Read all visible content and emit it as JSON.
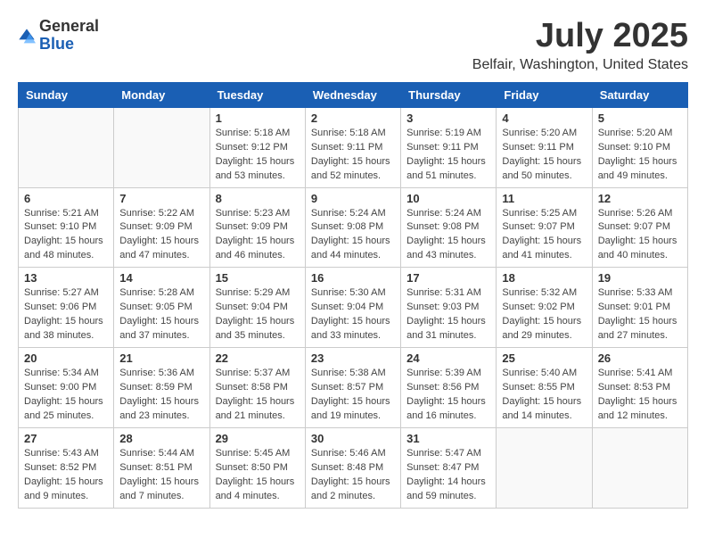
{
  "logo": {
    "general": "General",
    "blue": "Blue"
  },
  "title": "July 2025",
  "location": "Belfair, Washington, United States",
  "weekdays": [
    "Sunday",
    "Monday",
    "Tuesday",
    "Wednesday",
    "Thursday",
    "Friday",
    "Saturday"
  ],
  "weeks": [
    [
      {
        "day": "",
        "info": ""
      },
      {
        "day": "",
        "info": ""
      },
      {
        "day": "1",
        "info": "Sunrise: 5:18 AM\nSunset: 9:12 PM\nDaylight: 15 hours\nand 53 minutes."
      },
      {
        "day": "2",
        "info": "Sunrise: 5:18 AM\nSunset: 9:11 PM\nDaylight: 15 hours\nand 52 minutes."
      },
      {
        "day": "3",
        "info": "Sunrise: 5:19 AM\nSunset: 9:11 PM\nDaylight: 15 hours\nand 51 minutes."
      },
      {
        "day": "4",
        "info": "Sunrise: 5:20 AM\nSunset: 9:11 PM\nDaylight: 15 hours\nand 50 minutes."
      },
      {
        "day": "5",
        "info": "Sunrise: 5:20 AM\nSunset: 9:10 PM\nDaylight: 15 hours\nand 49 minutes."
      }
    ],
    [
      {
        "day": "6",
        "info": "Sunrise: 5:21 AM\nSunset: 9:10 PM\nDaylight: 15 hours\nand 48 minutes."
      },
      {
        "day": "7",
        "info": "Sunrise: 5:22 AM\nSunset: 9:09 PM\nDaylight: 15 hours\nand 47 minutes."
      },
      {
        "day": "8",
        "info": "Sunrise: 5:23 AM\nSunset: 9:09 PM\nDaylight: 15 hours\nand 46 minutes."
      },
      {
        "day": "9",
        "info": "Sunrise: 5:24 AM\nSunset: 9:08 PM\nDaylight: 15 hours\nand 44 minutes."
      },
      {
        "day": "10",
        "info": "Sunrise: 5:24 AM\nSunset: 9:08 PM\nDaylight: 15 hours\nand 43 minutes."
      },
      {
        "day": "11",
        "info": "Sunrise: 5:25 AM\nSunset: 9:07 PM\nDaylight: 15 hours\nand 41 minutes."
      },
      {
        "day": "12",
        "info": "Sunrise: 5:26 AM\nSunset: 9:07 PM\nDaylight: 15 hours\nand 40 minutes."
      }
    ],
    [
      {
        "day": "13",
        "info": "Sunrise: 5:27 AM\nSunset: 9:06 PM\nDaylight: 15 hours\nand 38 minutes."
      },
      {
        "day": "14",
        "info": "Sunrise: 5:28 AM\nSunset: 9:05 PM\nDaylight: 15 hours\nand 37 minutes."
      },
      {
        "day": "15",
        "info": "Sunrise: 5:29 AM\nSunset: 9:04 PM\nDaylight: 15 hours\nand 35 minutes."
      },
      {
        "day": "16",
        "info": "Sunrise: 5:30 AM\nSunset: 9:04 PM\nDaylight: 15 hours\nand 33 minutes."
      },
      {
        "day": "17",
        "info": "Sunrise: 5:31 AM\nSunset: 9:03 PM\nDaylight: 15 hours\nand 31 minutes."
      },
      {
        "day": "18",
        "info": "Sunrise: 5:32 AM\nSunset: 9:02 PM\nDaylight: 15 hours\nand 29 minutes."
      },
      {
        "day": "19",
        "info": "Sunrise: 5:33 AM\nSunset: 9:01 PM\nDaylight: 15 hours\nand 27 minutes."
      }
    ],
    [
      {
        "day": "20",
        "info": "Sunrise: 5:34 AM\nSunset: 9:00 PM\nDaylight: 15 hours\nand 25 minutes."
      },
      {
        "day": "21",
        "info": "Sunrise: 5:36 AM\nSunset: 8:59 PM\nDaylight: 15 hours\nand 23 minutes."
      },
      {
        "day": "22",
        "info": "Sunrise: 5:37 AM\nSunset: 8:58 PM\nDaylight: 15 hours\nand 21 minutes."
      },
      {
        "day": "23",
        "info": "Sunrise: 5:38 AM\nSunset: 8:57 PM\nDaylight: 15 hours\nand 19 minutes."
      },
      {
        "day": "24",
        "info": "Sunrise: 5:39 AM\nSunset: 8:56 PM\nDaylight: 15 hours\nand 16 minutes."
      },
      {
        "day": "25",
        "info": "Sunrise: 5:40 AM\nSunset: 8:55 PM\nDaylight: 15 hours\nand 14 minutes."
      },
      {
        "day": "26",
        "info": "Sunrise: 5:41 AM\nSunset: 8:53 PM\nDaylight: 15 hours\nand 12 minutes."
      }
    ],
    [
      {
        "day": "27",
        "info": "Sunrise: 5:43 AM\nSunset: 8:52 PM\nDaylight: 15 hours\nand 9 minutes."
      },
      {
        "day": "28",
        "info": "Sunrise: 5:44 AM\nSunset: 8:51 PM\nDaylight: 15 hours\nand 7 minutes."
      },
      {
        "day": "29",
        "info": "Sunrise: 5:45 AM\nSunset: 8:50 PM\nDaylight: 15 hours\nand 4 minutes."
      },
      {
        "day": "30",
        "info": "Sunrise: 5:46 AM\nSunset: 8:48 PM\nDaylight: 15 hours\nand 2 minutes."
      },
      {
        "day": "31",
        "info": "Sunrise: 5:47 AM\nSunset: 8:47 PM\nDaylight: 14 hours\nand 59 minutes."
      },
      {
        "day": "",
        "info": ""
      },
      {
        "day": "",
        "info": ""
      }
    ]
  ]
}
